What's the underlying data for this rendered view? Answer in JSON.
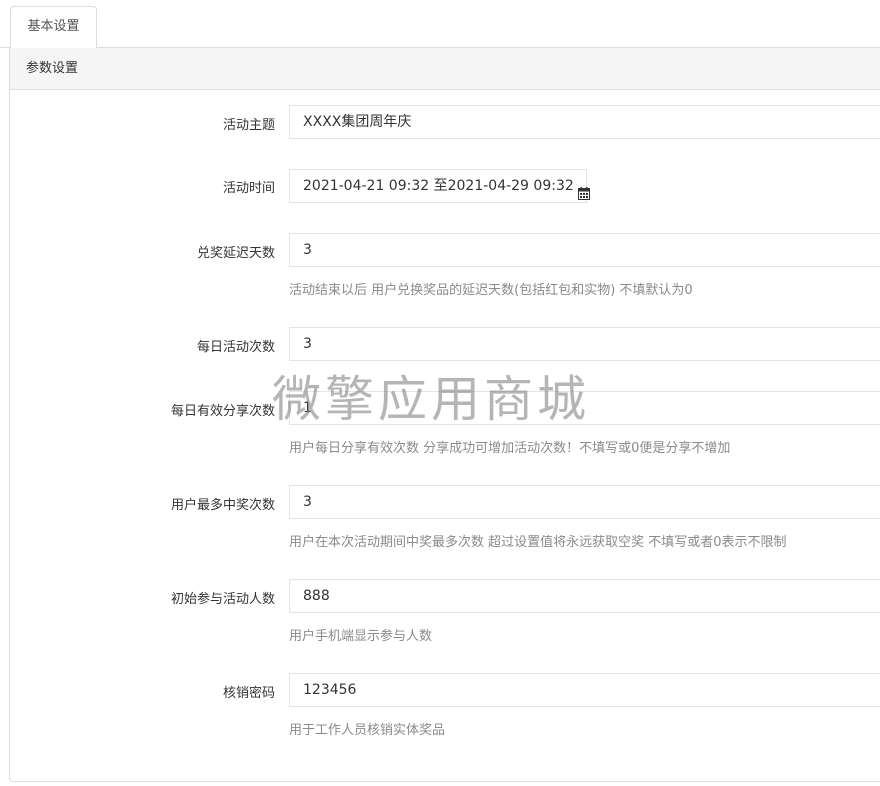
{
  "tabs": [
    {
      "label": "基本设置",
      "active": true
    }
  ],
  "panel": {
    "heading": "参数设置"
  },
  "form": {
    "theme": {
      "label": "活动主题",
      "value": "XXXX集团周年庆"
    },
    "time": {
      "label": "活动时间",
      "value": "2021-04-21 09:32 至2021-04-29 09:32",
      "icon": "calendar-icon"
    },
    "delay": {
      "label": "兑奖延迟天数",
      "value": "3",
      "help": "活动结束以后 用户兑换奖品的延迟天数(包括红包和实物) 不填默认为0"
    },
    "daily": {
      "label": "每日活动次数",
      "value": "3"
    },
    "share": {
      "label": "每日有效分享次数",
      "value": "1",
      "help": "用户每日分享有效次数 分享成功可增加活动次数！不填写或0便是分享不增加"
    },
    "maxwin": {
      "label": "用户最多中奖次数",
      "value": "3",
      "help": "用户在本次活动期间中奖最多次数 超过设置值将永远获取空奖 不填写或者0表示不限制"
    },
    "initial": {
      "label": "初始参与活动人数",
      "value": "888",
      "help": "用户手机端显示参与人数"
    },
    "password": {
      "label": "核销密码",
      "value": "123456",
      "help": "用于工作人员核销实体奖品"
    }
  },
  "watermark": "微擎应用商城",
  "colors": {
    "border": "#dddddd",
    "heading_bg": "#f5f5f5",
    "help_text": "#8a8a8a",
    "text": "#333333"
  }
}
